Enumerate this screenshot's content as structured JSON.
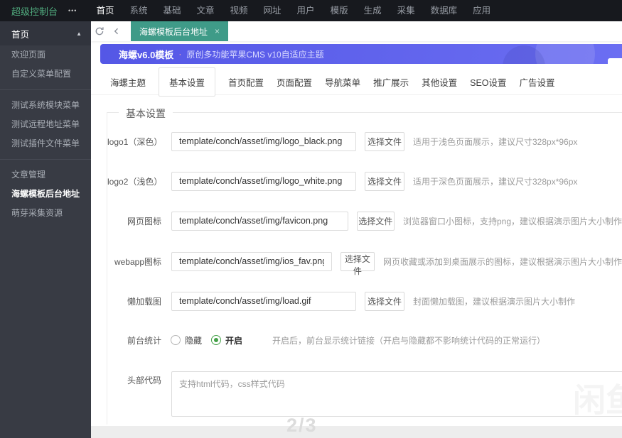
{
  "topbar": {
    "brand": "超级控制台",
    "more_icon": "•••",
    "nav": [
      {
        "label": "首页",
        "active": true
      },
      {
        "label": "系统"
      },
      {
        "label": "基础"
      },
      {
        "label": "文章"
      },
      {
        "label": "视频"
      },
      {
        "label": "网址"
      },
      {
        "label": "用户"
      },
      {
        "label": "模版"
      },
      {
        "label": "生成"
      },
      {
        "label": "采集"
      },
      {
        "label": "数据库"
      },
      {
        "label": "应用"
      }
    ]
  },
  "sidebar": {
    "groups": [
      {
        "header": "首页",
        "caret": "▲",
        "items": [
          {
            "label": "欢迎页面"
          },
          {
            "label": "自定义菜单配置"
          }
        ]
      },
      {
        "items": [
          {
            "label": "测试系统模块菜单"
          },
          {
            "label": "测试远程地址菜单"
          },
          {
            "label": "测试插件文件菜单"
          }
        ]
      },
      {
        "items": [
          {
            "label": "文章管理"
          },
          {
            "label": "海螺模板后台地址",
            "active": true
          },
          {
            "label": "萌芽采集资源"
          }
        ]
      }
    ]
  },
  "tabstrip": {
    "active_tab": "海螺模板后台地址",
    "close_icon": "×"
  },
  "banner": {
    "title": "海螺v6.0模板",
    "separator": "·",
    "subtitle": "原创多功能苹果CMS v10自适应主题"
  },
  "content": {
    "tabs": [
      {
        "label": "海螺主题"
      },
      {
        "label": "基本设置",
        "active": true
      },
      {
        "label": "首页配置"
      },
      {
        "label": "页面配置"
      },
      {
        "label": "导航菜单"
      },
      {
        "label": "推广展示"
      },
      {
        "label": "其他设置"
      },
      {
        "label": "SEO设置"
      },
      {
        "label": "广告设置"
      }
    ],
    "section_title": "基本设置",
    "file_rows": [
      {
        "label": "logo1（深色）",
        "value": "template/conch/asset/img/logo_black.png",
        "button": "选择文件",
        "hint": "适用于浅色页面展示，建议尺寸328px*96px"
      },
      {
        "label": "logo2（浅色）",
        "value": "template/conch/asset/img/logo_white.png",
        "button": "选择文件",
        "hint": "适用于深色页面展示，建议尺寸328px*96px"
      },
      {
        "label": "网页图标",
        "value": "template/conch/asset/img/favicon.png",
        "button": "选择文件",
        "hint": "浏览器窗口小图标，支持png，建议根据演示图片大小制作"
      },
      {
        "label": "webapp图标",
        "value": "template/conch/asset/img/ios_fav.png",
        "button": "选择文件",
        "hint": "网页收藏或添加到桌面展示的图标，建议根据演示图片大小制作"
      },
      {
        "label": "懒加载图",
        "value": "template/conch/asset/img/load.gif",
        "button": "选择文件",
        "hint": "封面懒加载图，建议根据演示图片大小制作"
      }
    ],
    "stats_radio": {
      "label": "前台统计",
      "options": [
        {
          "label": "隐藏",
          "checked": false
        },
        {
          "label": "开启",
          "checked": true
        }
      ],
      "hint": "开启后，前台显示统计链接（开启与隐藏都不影响统计代码的正常运行）"
    },
    "head_code": {
      "label": "头部代码",
      "placeholder": "支持html代码，css样式代码"
    }
  },
  "overlays": {
    "page_indicator": "2/3",
    "watermark": "闲鱼"
  },
  "colors": {
    "topbar_bg": "#17191e",
    "sidebar_bg": "#383b44",
    "tab_green": "#3f9b88",
    "brand_green": "#4fa87c",
    "banner_purple": "#5a5de8",
    "radio_green": "#43a047"
  }
}
